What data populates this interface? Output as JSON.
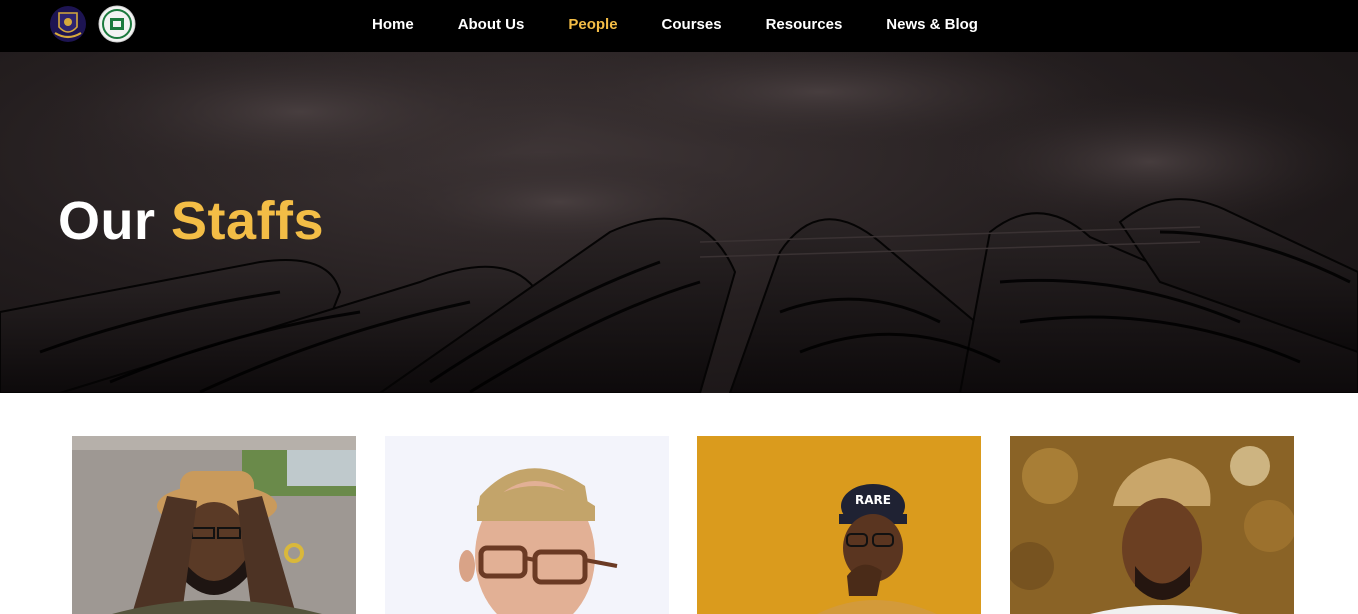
{
  "nav": {
    "logos": [
      {
        "name": "university-crest-logo"
      },
      {
        "name": "department-seal-logo"
      }
    ],
    "items": [
      {
        "label": "Home",
        "active": false
      },
      {
        "label": "About Us",
        "active": false
      },
      {
        "label": "People",
        "active": true
      },
      {
        "label": "Courses",
        "active": false
      },
      {
        "label": "Resources",
        "active": false
      },
      {
        "label": "News & Blog",
        "active": false
      }
    ]
  },
  "hero": {
    "title_main": "Our",
    "title_accent": "Staffs"
  },
  "colors": {
    "nav_bg": "#000000",
    "accent": "#f3bd46",
    "text_light": "#ffffff"
  },
  "staff": [
    {
      "photo": "staff-photo-man-straw-hat"
    },
    {
      "photo": "staff-photo-man-glasses"
    },
    {
      "photo": "staff-photo-man-cap-yellow-background"
    },
    {
      "photo": "staff-photo-man-traditional-cap"
    }
  ]
}
